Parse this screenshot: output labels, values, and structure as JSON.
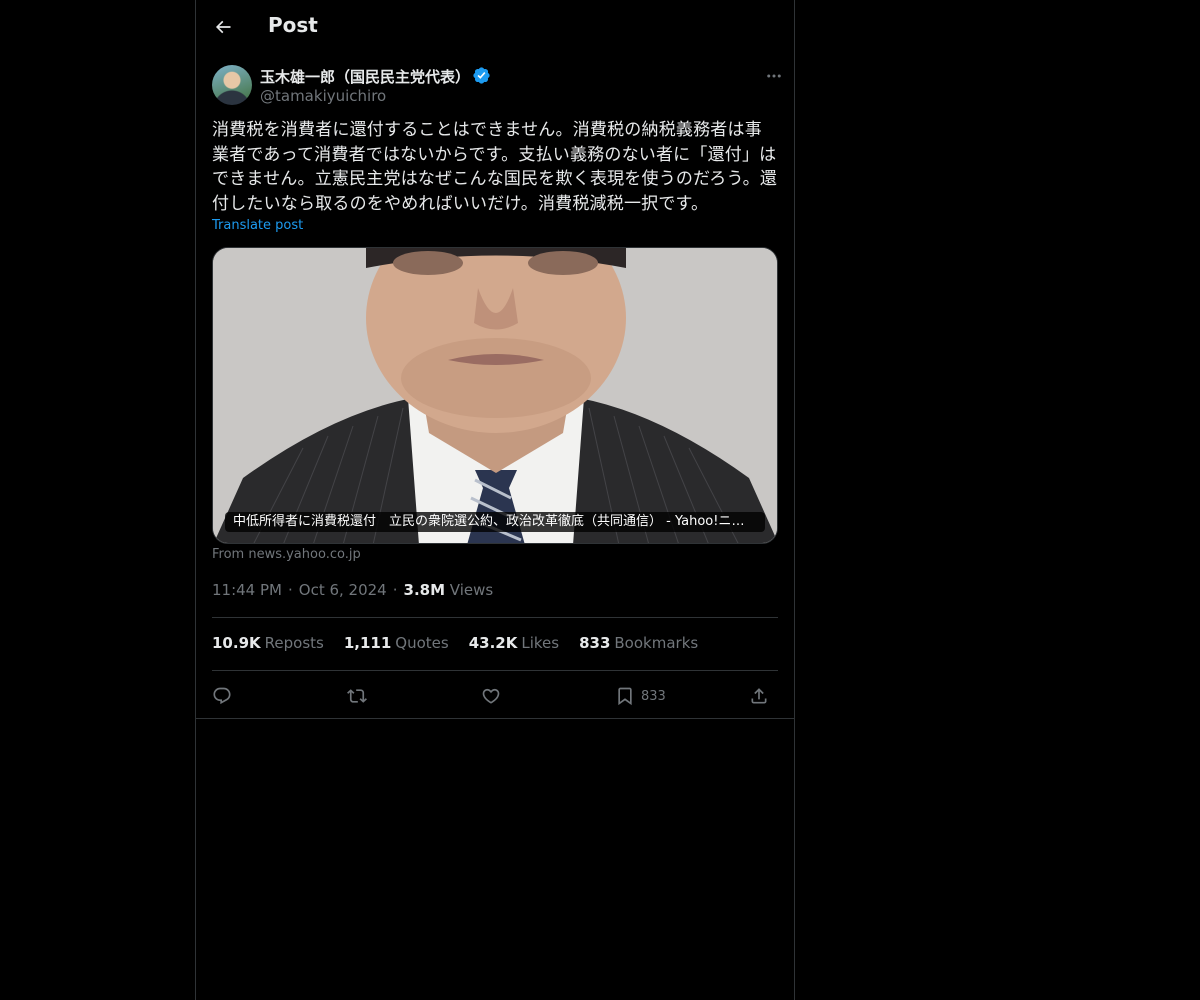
{
  "header": {
    "title": "Post"
  },
  "author": {
    "name": "玉木雄一郎（国民民主党代表）",
    "handle": "@tamakiyuichiro"
  },
  "post": {
    "text": "消費税を消費者に還付することはできません。消費税の納税義務者は事業者であって消費者ではないからです。支払い義務のない者に「還付」はできません。立憲民主党はなぜこんな国民を欺く表現を使うのだろう。還付したいなら取るのをやめればいいだけ。消費税減税一択です。",
    "translate_label": "Translate post"
  },
  "card": {
    "caption": "中低所得者に消費税還付　立民の衆院選公約、政治改革徹底（共同通信） - Yahoo!ニュース",
    "source": "From news.yahoo.co.jp"
  },
  "meta": {
    "time": "11:44 PM",
    "date": "Oct 6, 2024",
    "views_count": "3.8M",
    "views_label": "Views"
  },
  "stats": [
    {
      "count": "10.9K",
      "label": "Reposts"
    },
    {
      "count": "1,111",
      "label": "Quotes"
    },
    {
      "count": "43.2K",
      "label": "Likes"
    },
    {
      "count": "833",
      "label": "Bookmarks"
    }
  ],
  "actions": {
    "bookmark_count": "833"
  },
  "icons": {
    "back": "arrow-left-icon",
    "verified": "verified-badge-icon",
    "more": "more-horizontal-icon",
    "reply": "reply-icon",
    "repost": "repost-icon",
    "like": "heart-icon",
    "bookmark": "bookmark-icon",
    "share": "share-icon"
  },
  "colors": {
    "background": "#000000",
    "text": "#e7e9ea",
    "secondary": "#71767b",
    "accent": "#1d9bf0",
    "border": "#2f3336"
  }
}
